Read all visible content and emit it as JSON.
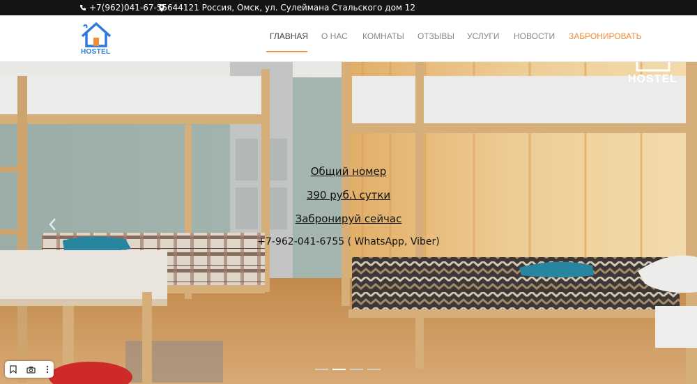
{
  "topbar": {
    "phone": "+7(962)041-67-55",
    "address": "644121 Россия, Омск, ул. Сулеймана Стальского дом 12",
    "phone_icon": "phone-icon",
    "address_icon": "map-marker-icon"
  },
  "logo": {
    "text": "HOSTEL"
  },
  "nav": {
    "items": [
      {
        "label": "Главная"
      },
      {
        "label": "О нас"
      },
      {
        "label": "Комнаты"
      },
      {
        "label": "Отзывы"
      },
      {
        "label": "Услуги"
      },
      {
        "label": "Новости"
      },
      {
        "label": "Забронировать"
      }
    ],
    "active_index": 0
  },
  "hero": {
    "title": "Общий номер",
    "price": "390 руб.\\ сутки",
    "cta": "Забронируй сейчас",
    "phone": "+7-962-041-6755 ( WhatsApp, Viber)",
    "watermark": "HOSTEL",
    "slides_count": 4,
    "active_slide": 1
  },
  "toolbar": {
    "icons": [
      "bookmark-icon",
      "camera-icon",
      "more-icon"
    ]
  },
  "colors": {
    "accent": "#f08c3a",
    "topbar_bg": "#141414",
    "logo_blue": "#2f79d6"
  }
}
